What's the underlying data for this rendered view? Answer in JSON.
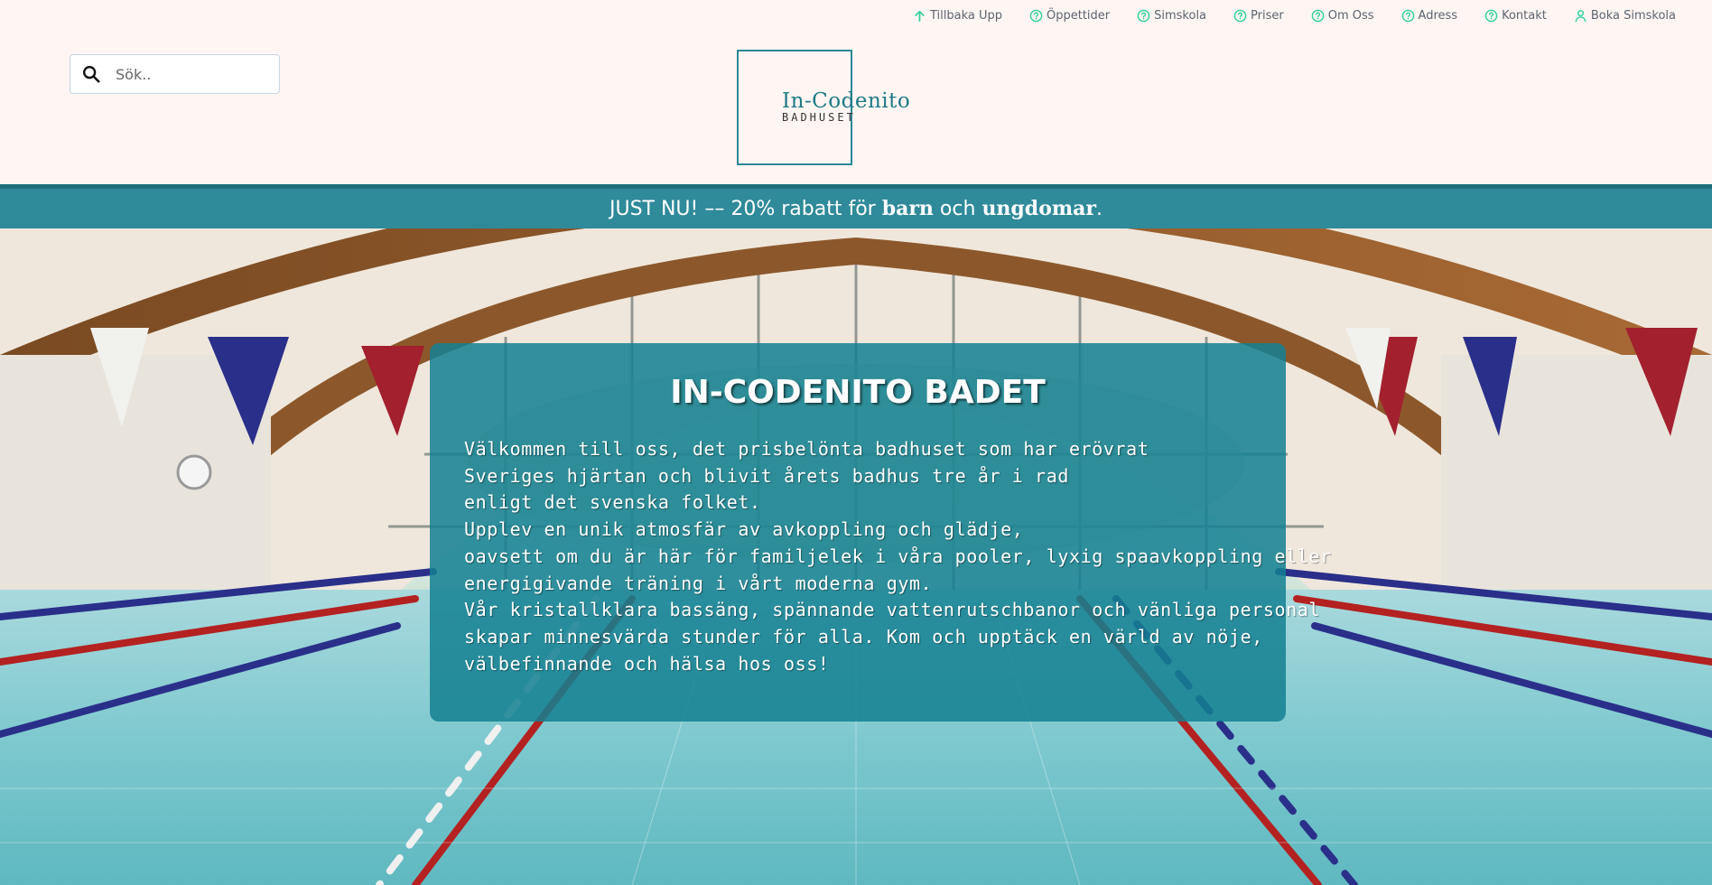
{
  "nav": {
    "items": [
      {
        "label": "Tillbaka Upp",
        "icon": "arrow-up-icon"
      },
      {
        "label": "Öppettider",
        "icon": "help-circle-icon"
      },
      {
        "label": "Simskola",
        "icon": "help-circle-icon"
      },
      {
        "label": "Priser",
        "icon": "help-circle-icon"
      },
      {
        "label": "Om Oss",
        "icon": "help-circle-icon"
      },
      {
        "label": "Adress",
        "icon": "help-circle-icon"
      },
      {
        "label": "Kontakt",
        "icon": "help-circle-icon"
      },
      {
        "label": "Boka Simskola",
        "icon": "user-icon"
      }
    ],
    "icon_color": "#2fcf9a"
  },
  "search": {
    "placeholder": "Sök..",
    "value": ""
  },
  "logo": {
    "title": "In-Codenito",
    "subtitle": "BADHUSET"
  },
  "promo": {
    "prefix": "JUST NU! –– 20% rabatt för ",
    "bold1": "barn",
    "middle": " och ",
    "bold2": "ungdomar",
    "suffix": "."
  },
  "hero": {
    "title": "IN-CODENITO BADET",
    "lines": [
      "Välkommen till oss, det prisbelönta badhuset som har erövrat",
      "Sveriges hjärtan och blivit årets badhus tre år i rad",
      "enligt det svenska folket.",
      "Upplev en unik atmosfär av avkoppling och glädje,",
      "oavsett om du är här för familjelek i våra pooler, lyxig spaavkoppling eller",
      "energigivande träning i vårt moderna gym.",
      "Vår kristallklara bassäng, spännande vattenrutschbanor och vänliga personal",
      "skapar minnesvärda stunder för alla. Kom och upptäck en värld av nöje,",
      "välbefinnande och hälsa hos oss!"
    ]
  },
  "colors": {
    "header_bg": "#fff6f3",
    "accent": "#2f8a9a",
    "card_bg": "#148091"
  }
}
